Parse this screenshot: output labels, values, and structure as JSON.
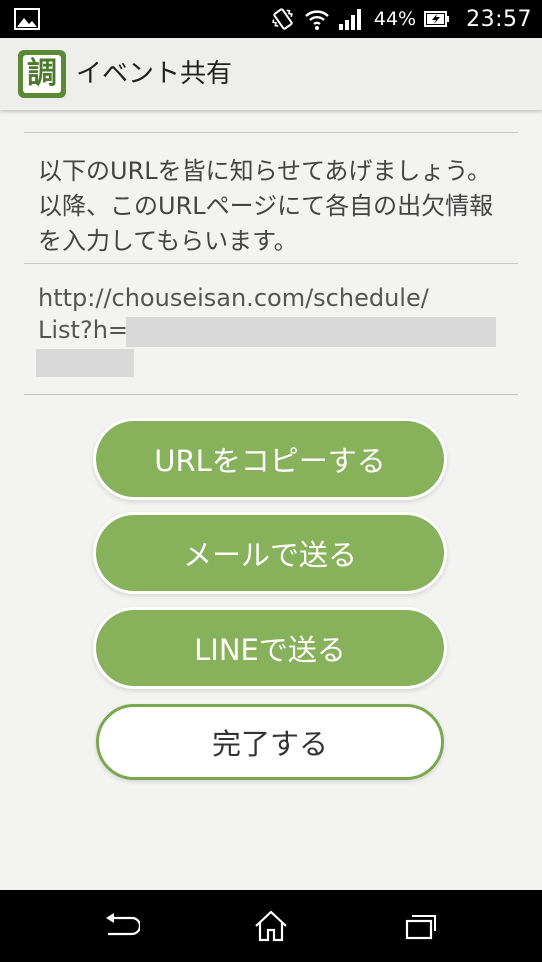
{
  "status_bar": {
    "left_icon": "image-icon",
    "icons": [
      "vibrate-icon",
      "wifi-icon",
      "signal-icon",
      "battery-charging-icon"
    ],
    "battery_percent": "44%",
    "time": "23:57"
  },
  "action_bar": {
    "logo_char": "調",
    "title": "イベント共有"
  },
  "main": {
    "instruction": "以下のURLを皆に知らせてあげましょう。以降、このURLページにて各自の出欠情報を入力してもらいます。",
    "url_line1": "http://chouseisan.com/schedule/",
    "url_line2_prefix": "List?h="
  },
  "buttons": {
    "copy_url": "URLをコピーする",
    "send_mail": "メールで送る",
    "send_line": "LINEで送る",
    "done": "完了する"
  },
  "nav_bar": {
    "icons": [
      "back-icon",
      "home-icon",
      "recent-apps-icon"
    ]
  },
  "colors": {
    "accent_green": "#87b15b",
    "logo_green": "#5a8a35"
  }
}
